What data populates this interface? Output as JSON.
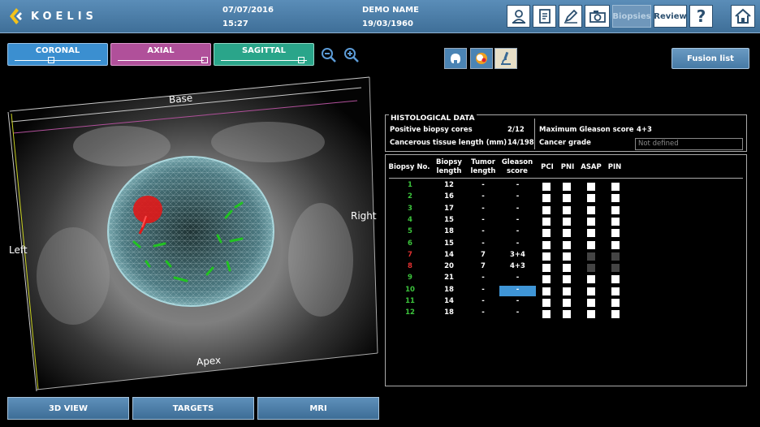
{
  "header": {
    "logo_text": "KOELIS",
    "date": "07/07/2016",
    "time": "15:27",
    "patient_name": "DEMO NAME",
    "patient_dob": "19/03/1960",
    "biopsies_label": "Biopsies",
    "review_label": "Review",
    "help_label": "?"
  },
  "view_tabs": [
    {
      "label": "CORONAL",
      "color": "#3b8fd0",
      "slider_value": 0.35
    },
    {
      "label": "AXIAL",
      "color": "#b0509a",
      "slider_value": 0.95
    },
    {
      "label": "SAGITTAL",
      "color": "#2aa58a",
      "slider_value": 0.88
    }
  ],
  "fusion_list_label": "Fusion list",
  "viewport_labels": {
    "base": "Base",
    "apex": "Apex",
    "left": "Left",
    "right": "Right"
  },
  "bottom_buttons": [
    "3D VIEW",
    "TARGETS",
    "MRI"
  ],
  "histology": {
    "title": "HISTOLOGICAL DATA",
    "positive_cores_label": "Positive biopsy cores",
    "positive_cores_value": "2/12",
    "cancerous_length_label": "Cancerous tissue length (mm)",
    "cancerous_length_value": "14/198",
    "max_gleason_label": "Maximum Gleason score",
    "max_gleason_value": "4+3",
    "cancer_grade_label": "Cancer grade",
    "cancer_grade_value": "Not defined"
  },
  "table": {
    "headers": {
      "biopsy_no": "Biopsy No.",
      "biopsy_length": "Biopsy length",
      "tumor_length": "Tumor length",
      "gleason": "Gleason score",
      "pci": "PCI",
      "pni": "PNI",
      "asap": "ASAP",
      "pin": "PIN"
    },
    "rows": [
      {
        "no": "1",
        "length": "12",
        "tumor": "-",
        "gleason": "-",
        "color": "#3cc43c",
        "positive": false
      },
      {
        "no": "2",
        "length": "16",
        "tumor": "-",
        "gleason": "-",
        "color": "#3cc43c",
        "positive": false
      },
      {
        "no": "3",
        "length": "17",
        "tumor": "-",
        "gleason": "-",
        "color": "#3cc43c",
        "positive": false
      },
      {
        "no": "4",
        "length": "15",
        "tumor": "-",
        "gleason": "-",
        "color": "#3cc43c",
        "positive": false
      },
      {
        "no": "5",
        "length": "18",
        "tumor": "-",
        "gleason": "-",
        "color": "#3cc43c",
        "positive": false
      },
      {
        "no": "6",
        "length": "15",
        "tumor": "-",
        "gleason": "-",
        "color": "#3cc43c",
        "positive": false
      },
      {
        "no": "7",
        "length": "14",
        "tumor": "7",
        "gleason": "3+4",
        "color": "#e03030",
        "positive": true
      },
      {
        "no": "8",
        "length": "20",
        "tumor": "7",
        "gleason": "4+3",
        "color": "#e03030",
        "positive": true
      },
      {
        "no": "9",
        "length": "21",
        "tumor": "-",
        "gleason": "-",
        "color": "#3cc43c",
        "positive": false
      },
      {
        "no": "10",
        "length": "18",
        "tumor": "-",
        "gleason": "-",
        "color": "#3cc43c",
        "positive": false,
        "selected": true
      },
      {
        "no": "11",
        "length": "14",
        "tumor": "-",
        "gleason": "-",
        "color": "#3cc43c",
        "positive": false
      },
      {
        "no": "12",
        "length": "18",
        "tumor": "-",
        "gleason": "-",
        "color": "#3cc43c",
        "positive": false
      }
    ]
  },
  "colors": {
    "accent": "#3b8fd0",
    "selected_cell": "#3f95d6"
  }
}
